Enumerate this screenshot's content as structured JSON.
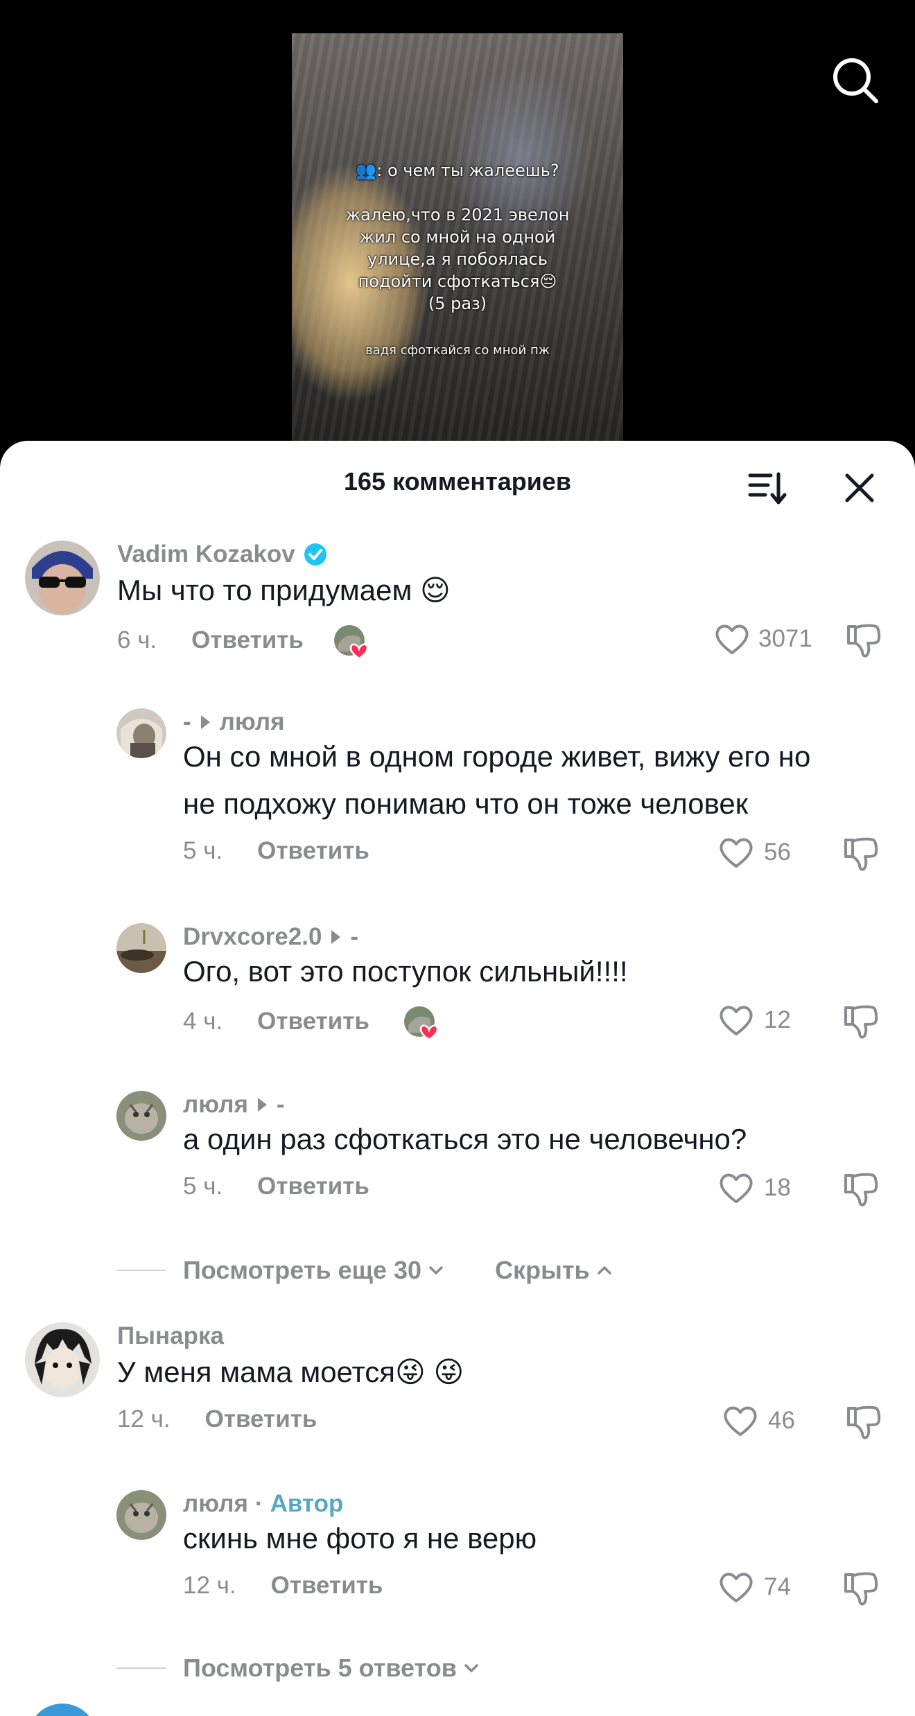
{
  "video": {
    "caption_line1": "👥: о чем ты жалеешь?",
    "caption_lines": [
      "жалею,что в 2021 эвелон",
      "жил со мной на одной",
      "улице,а я побоялась",
      "подойти сфоткаться😔",
      "(5 раз)"
    ],
    "caption_small": "вадя сфоткайся со мной пж"
  },
  "sheet": {
    "title": "165 комментариев"
  },
  "comments": [
    {
      "user": "Vadim Kozakov",
      "verified": true,
      "text": "Мы что то придумаем 😌",
      "time": "6 ч.",
      "reply": "Ответить",
      "likes": "3071",
      "liked_by_author": true
    },
    {
      "user": "-",
      "reply_to": "люля",
      "text_lines": [
        "Он со мной в одном городе живет, вижу его но",
        "не подхожу понимаю что он тоже человек"
      ],
      "time": "5 ч.",
      "reply": "Ответить",
      "likes": "56"
    },
    {
      "user": "Drvxcore2.0",
      "reply_to": "-",
      "text": "Ого, вот это поступок сильный!!!!",
      "time": "4 ч.",
      "reply": "Ответить",
      "likes": "12",
      "liked_by_author": true
    },
    {
      "user": "люля",
      "reply_to": "-",
      "text": "а один раз сфоткаться это не человечно?",
      "time": "5 ч.",
      "reply": "Ответить",
      "likes": "18"
    },
    {
      "user": "Пынарка",
      "text": "У меня мама моется😜 😜",
      "time": "12 ч.",
      "reply": "Ответить",
      "likes": "46"
    },
    {
      "user": "люля",
      "author_badge": "Автор",
      "separator": "·",
      "text": "скинь мне фото я не верю",
      "time": "12 ч.",
      "reply": "Ответить",
      "likes": "74"
    }
  ],
  "thread1": {
    "view_more": "Посмотреть еще 30",
    "hide": "Скрыть"
  },
  "thread2": {
    "view_more": "Посмотреть 5 ответов"
  },
  "colors": {
    "accent_author": "#57a7c4",
    "verified": "#20c4f4",
    "heart_red": "#fe2c55",
    "muted": "#8a8b91",
    "text": "#161823"
  }
}
